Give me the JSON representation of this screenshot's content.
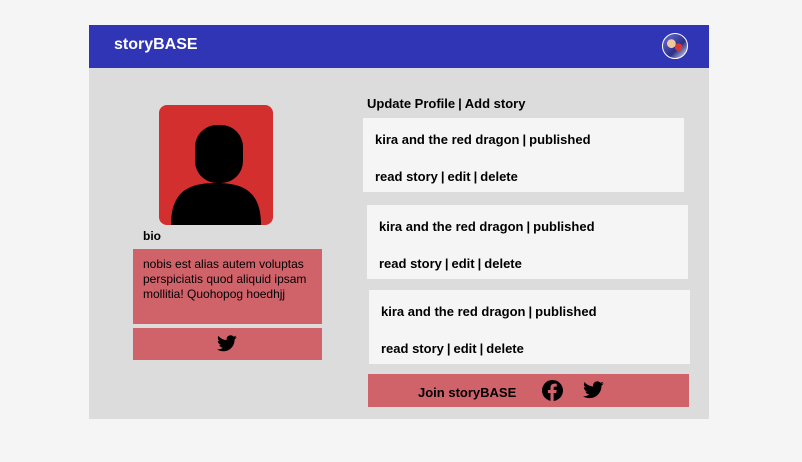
{
  "header": {
    "brand": "storyBASE",
    "avatar_icon": "user-avatar-icon"
  },
  "profile": {
    "bio_label": "bio",
    "bio_text": "nobis est alias autem voluptas perspiciatis quod aliquid ipsam mollitia! Quohopog hoedhjj",
    "social_icon": "twitter-icon"
  },
  "actions": {
    "update_profile": "Update Profile",
    "separator": "|",
    "add_story": "Add story"
  },
  "stories": [
    {
      "title": "kira and the red dragon",
      "status": "published",
      "read": "read story",
      "edit": "edit",
      "delete": "delete"
    },
    {
      "title": "kira and the red dragon",
      "status": "published",
      "read": "read story",
      "edit": "edit",
      "delete": "delete"
    },
    {
      "title": "kira and the red dragon",
      "status": "published",
      "read": "read story",
      "edit": "edit",
      "delete": "delete"
    }
  ],
  "footer": {
    "join_label": "Join storyBASE",
    "icons": [
      "facebook-icon",
      "twitter-icon"
    ]
  },
  "colors": {
    "nav": "#3035b6",
    "panel": "#dcdcdc",
    "accent": "#d0626a",
    "avatar": "#d42f2f",
    "card": "#f5f5f5"
  }
}
